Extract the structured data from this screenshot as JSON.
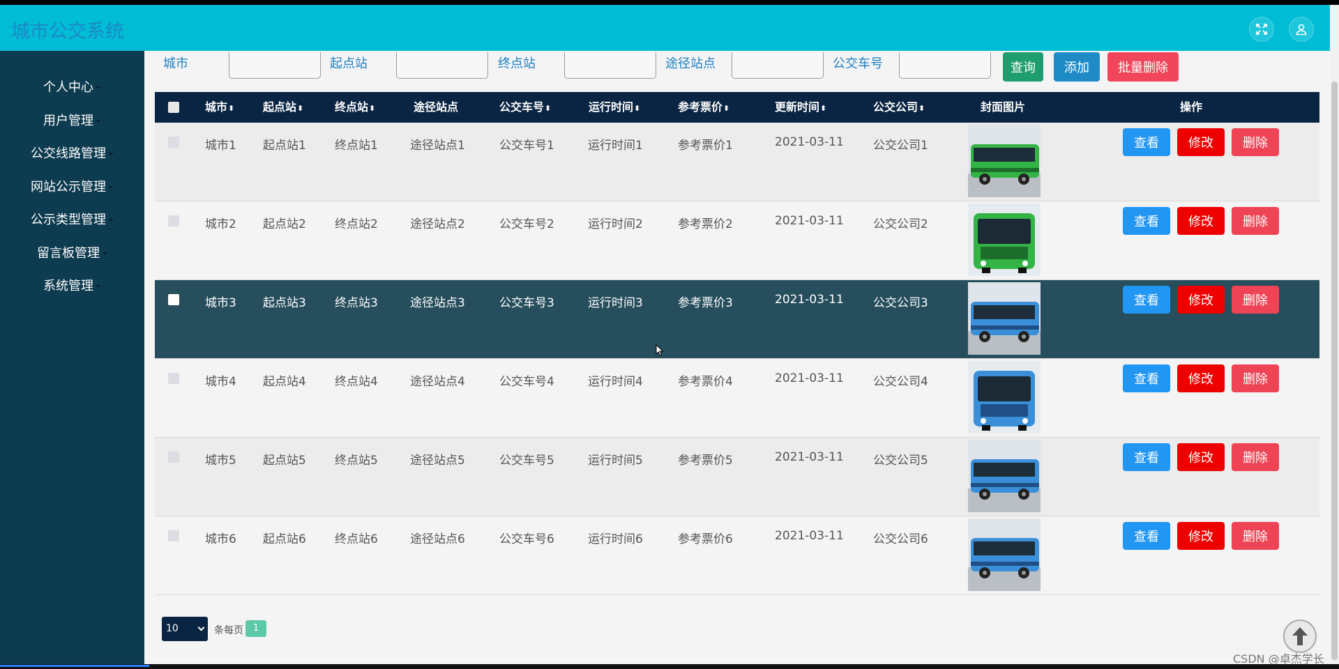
{
  "app": {
    "title": "城市公交系统"
  },
  "header": {
    "fullscreen_icon": "fullscreen-icon",
    "user_icon": "user-icon"
  },
  "sidebar": {
    "items": [
      {
        "label": "个人中心"
      },
      {
        "label": "用户管理"
      },
      {
        "label": "公交线路管理"
      },
      {
        "label": "网站公示管理"
      },
      {
        "label": "公示类型管理"
      },
      {
        "label": "留言板管理"
      },
      {
        "label": "系统管理"
      }
    ]
  },
  "search": {
    "fields": [
      {
        "label": "城市",
        "value": ""
      },
      {
        "label": "起点站",
        "value": ""
      },
      {
        "label": "终点站",
        "value": ""
      },
      {
        "label": "途径站点",
        "value": ""
      },
      {
        "label": "公交车号",
        "value": ""
      }
    ],
    "query_label": "查询",
    "add_label": "添加",
    "batch_delete_label": "批量删除"
  },
  "table": {
    "headers": [
      "城市",
      "起点站",
      "终点站",
      "途径站点",
      "公交车号",
      "运行时间",
      "参考票价",
      "更新时间",
      "公交公司",
      "封面图片",
      "操作"
    ],
    "sort_glyph": "⬍",
    "rows": [
      {
        "city": "城市1",
        "start": "起点站1",
        "end": "终点站1",
        "via": "途径站点1",
        "bus_no": "公交车号1",
        "run_time": "运行时间1",
        "fare": "参考票价1",
        "updated": "2021-03-11",
        "company": "公交公司1",
        "image": "green-bus"
      },
      {
        "city": "城市2",
        "start": "起点站2",
        "end": "终点站2",
        "via": "途径站点2",
        "bus_no": "公交车号2",
        "run_time": "运行时间2",
        "fare": "参考票价2",
        "updated": "2021-03-11",
        "company": "公交公司2",
        "image": "green-bus-front"
      },
      {
        "city": "城市3",
        "start": "起点站3",
        "end": "终点站3",
        "via": "途径站点3",
        "bus_no": "公交车号3",
        "run_time": "运行时间3",
        "fare": "参考票价3",
        "updated": "2021-03-11",
        "company": "公交公司3",
        "image": "blue-bus"
      },
      {
        "city": "城市4",
        "start": "起点站4",
        "end": "终点站4",
        "via": "途径站点4",
        "bus_no": "公交车号4",
        "run_time": "运行时间4",
        "fare": "参考票价4",
        "updated": "2021-03-11",
        "company": "公交公司4",
        "image": "blue-bus-front"
      },
      {
        "city": "城市5",
        "start": "起点站5",
        "end": "终点站5",
        "via": "途径站点5",
        "bus_no": "公交车号5",
        "run_time": "运行时间5",
        "fare": "参考票价5",
        "updated": "2021-03-11",
        "company": "公交公司5",
        "image": "blue-bus"
      },
      {
        "city": "城市6",
        "start": "起点站6",
        "end": "终点站6",
        "via": "途径站点6",
        "bus_no": "公交车号6",
        "run_time": "运行时间6",
        "fare": "参考票价6",
        "updated": "2021-03-11",
        "company": "公交公司6",
        "image": "blue-bus"
      }
    ],
    "actions": {
      "view": "查看",
      "edit": "修改",
      "delete": "删除"
    }
  },
  "pagination": {
    "page_size": "10",
    "per_page_label": "条每页",
    "current_page": "1"
  },
  "watermark": "CSDN @卓杰学长",
  "colors": {
    "topbar": "#00bcd4",
    "sidebar": "#0d3b4f",
    "table_header": "#0a2543",
    "highlight_row": "#264e5d",
    "query": "#1e9e6e",
    "add": "#1f8bc6",
    "batch_delete": "#f0455a",
    "view": "#2196f3",
    "edit": "#ee0000",
    "delete": "#ee4455"
  }
}
